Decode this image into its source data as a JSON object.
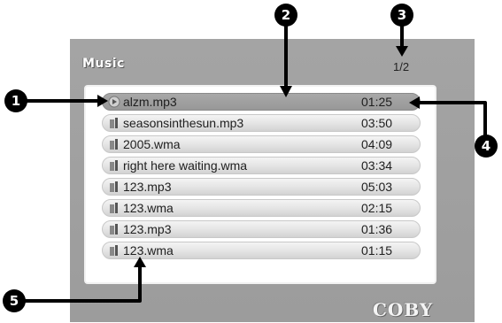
{
  "screen": {
    "title": "Music",
    "page_indicator": "1/2",
    "brand_logo": "COBY",
    "selected_index": 0,
    "tracks": [
      {
        "name": "alzm.mp3",
        "time": "01:25",
        "icon": "play-icon"
      },
      {
        "name": "seasonsinthesun.mp3",
        "time": "03:50",
        "icon": "music-file-icon"
      },
      {
        "name": "2005.wma",
        "time": "04:09",
        "icon": "music-file-icon"
      },
      {
        "name": "right here waiting.wma",
        "time": "03:34",
        "icon": "music-file-icon"
      },
      {
        "name": "123.mp3",
        "time": "05:03",
        "icon": "music-file-icon"
      },
      {
        "name": "123.wma",
        "time": "02:15",
        "icon": "music-file-icon"
      },
      {
        "name": "123.mp3",
        "time": "01:36",
        "icon": "music-file-icon"
      },
      {
        "name": "123.wma",
        "time": "01:15",
        "icon": "music-file-icon"
      }
    ]
  },
  "callouts": [
    "1",
    "2",
    "3",
    "4",
    "5"
  ]
}
